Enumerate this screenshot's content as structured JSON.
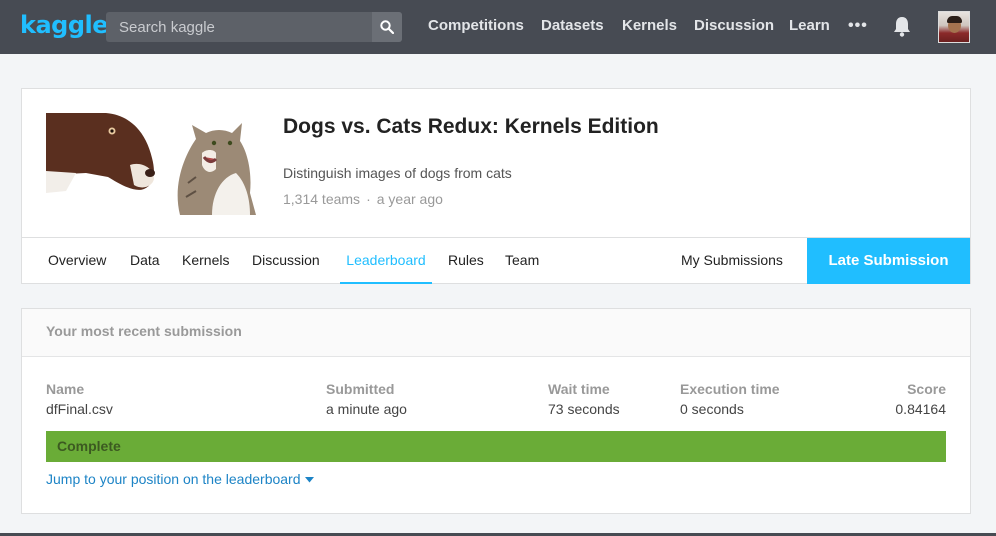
{
  "nav": {
    "logo": "kaggle",
    "search_placeholder": "Search kaggle",
    "links": [
      "Competitions",
      "Datasets",
      "Kernels",
      "Discussion",
      "Learn"
    ],
    "more_glyph": "•••",
    "icons": [
      "search-icon",
      "more-icon",
      "bell-icon",
      "avatar"
    ]
  },
  "competition": {
    "title": "Dogs vs. Cats Redux: Kernels Edition",
    "description": "Distinguish images of dogs from cats",
    "teams": "1,314 teams",
    "separator": "·",
    "time": "a year ago",
    "tabs": [
      "Overview",
      "Data",
      "Kernels",
      "Discussion",
      "Leaderboard",
      "Rules",
      "Team"
    ],
    "active_tab": "Leaderboard",
    "my_submissions": "My Submissions",
    "late_submission": "Late Submission"
  },
  "submission": {
    "header": "Your most recent submission",
    "columns": {
      "name": {
        "label": "Name",
        "value": "dfFinal.csv"
      },
      "submitted": {
        "label": "Submitted",
        "value": "a minute ago"
      },
      "wait": {
        "label": "Wait time",
        "value": "73 seconds"
      },
      "execution": {
        "label": "Execution time",
        "value": "0 seconds"
      },
      "score": {
        "label": "Score",
        "value": "0.84164"
      }
    },
    "status": "Complete",
    "jump_link": "Jump to your position on the leaderboard"
  },
  "colors": {
    "accent": "#20beff",
    "nav_bg": "#474b53",
    "status_green": "#6aac37"
  }
}
